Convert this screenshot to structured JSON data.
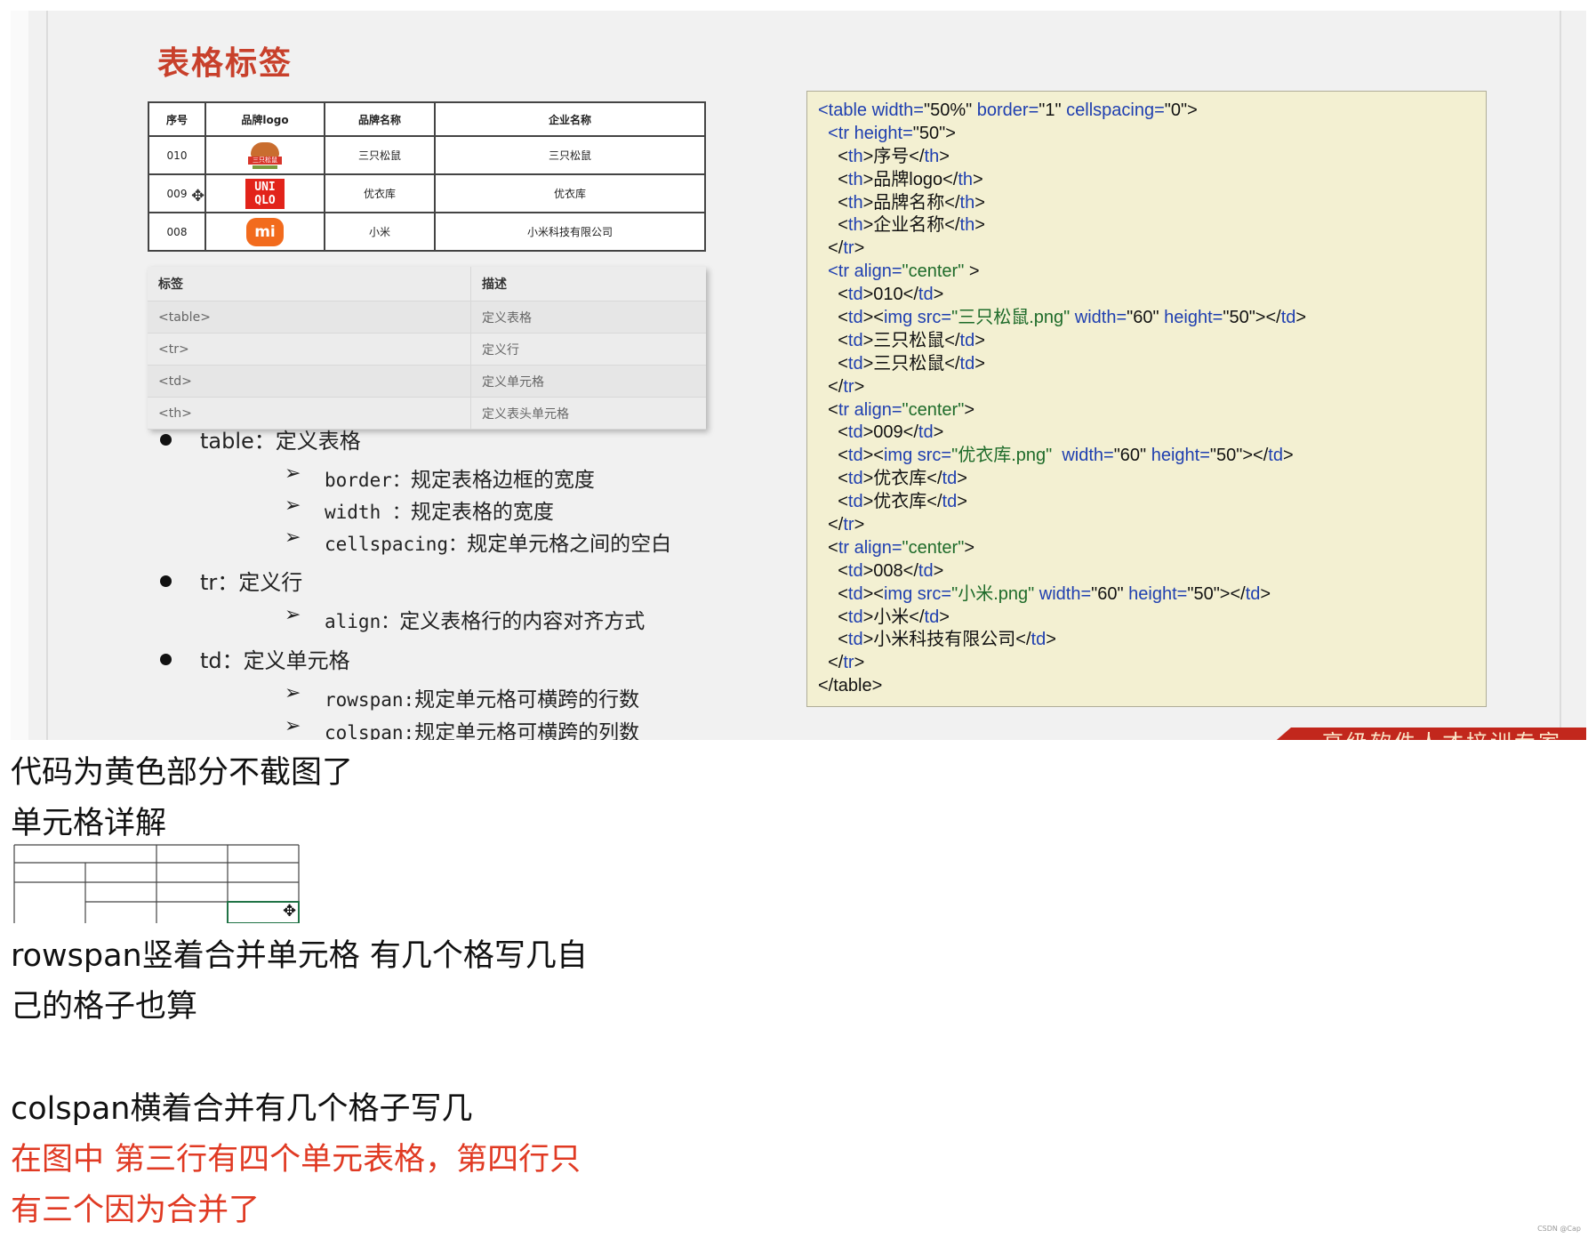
{
  "slide": {
    "title": "表格标签",
    "brand_table": {
      "headers": [
        "序号",
        "品牌logo",
        "品牌名称",
        "企业名称"
      ],
      "rows": [
        {
          "id": "010",
          "logo_text": "三只松鼠",
          "name": "三只松鼠",
          "company": "三只松鼠"
        },
        {
          "id": "009",
          "logo_text": "UNI QLO",
          "name": "优衣库",
          "company": "优衣库"
        },
        {
          "id": "008",
          "logo_text": "mi",
          "name": "小米",
          "company": "小米科技有限公司"
        }
      ]
    },
    "desc_table": {
      "headers": [
        "标签",
        "描述"
      ],
      "rows": [
        [
          "<table>",
          "定义表格"
        ],
        [
          "<tr>",
          "定义行"
        ],
        [
          "<td>",
          "定义单元格"
        ],
        [
          "<th>",
          "定义表头单元格"
        ]
      ]
    },
    "notes": {
      "b1": "table：定义表格",
      "b1_sub": [
        {
          "key": "border：",
          "text": "规定表格边框的宽度"
        },
        {
          "key": "width ：",
          "text": "规定表格的宽度"
        },
        {
          "key": "cellspacing：",
          "text": "规定单元格之间的空白"
        }
      ],
      "b2": "tr：定义行",
      "b2_sub": [
        {
          "key": "align：",
          "text": "定义表格行的内容对齐方式"
        }
      ],
      "b3": "td：定义单元格",
      "b3_sub": [
        {
          "key": "rowspan:",
          "text": "规定单元格可横跨的行数"
        },
        {
          "key": "colspan:",
          "text": "规定单元格可横跨的列数"
        }
      ]
    },
    "code": {
      "l01a": "<table ",
      "l01b": "width=",
      "l01c": "\"50%\"",
      "l01d": " border=",
      "l01e": "\"1\"",
      "l01f": " cellspacing=",
      "l01g": "\"0\"",
      "l01h": ">",
      "l02a": "<tr ",
      "l02b": "height=",
      "l02c": "\"50\"",
      "l02d": ">",
      "l03": "序号",
      "l04": "品牌logo",
      "l05": "品牌名称",
      "l06": "企业名称",
      "l08a": "<tr ",
      "l08b": "align=",
      "l08c": "\"center\"",
      "l08d": " >",
      "l09": "010",
      "l10a": "\"三只松鼠.png\"",
      "l10b": "\"60\"",
      "l10c": "\"50\"",
      "l11": "三只松鼠",
      "l12": "三只松鼠",
      "l14c": "\"center\"",
      "l15": "009",
      "l16a": "\"优衣库.png\"",
      "l16b": "\"60\"",
      "l16c": "\"50\"",
      "l17": "优衣库",
      "l18": "优衣库",
      "l20c": "\"center\"",
      "l21": "008",
      "l22a": "\"小米.png\"",
      "l22b": "\"60\"",
      "l22c": "\"50\"",
      "l23": "小米",
      "l24": "小米科技有限公司",
      "close_table": "</table>"
    },
    "banner": "高级软件人才培训专家"
  },
  "article": {
    "p1": "代码为黄色部分不截图了",
    "p2": "单元格详解",
    "p3": "rowspan竖着合并单元格 有几个格写几自",
    "p4": "己的格子也算",
    "p5": "colspan横着合并有几个格子写几",
    "p6": "在图中 第三行有四个单元表格，第四行只",
    "p7": "有三个因为合并了",
    "watermark": "CSDN @Cap"
  },
  "colors": {
    "title_red": "#c8402b",
    "code_bg": "#f3f0d2",
    "tag_blue": "#1f3fb0",
    "string_green": "#1e6b2a",
    "note_red": "#e03a23",
    "banner_red": "#c2271c"
  }
}
